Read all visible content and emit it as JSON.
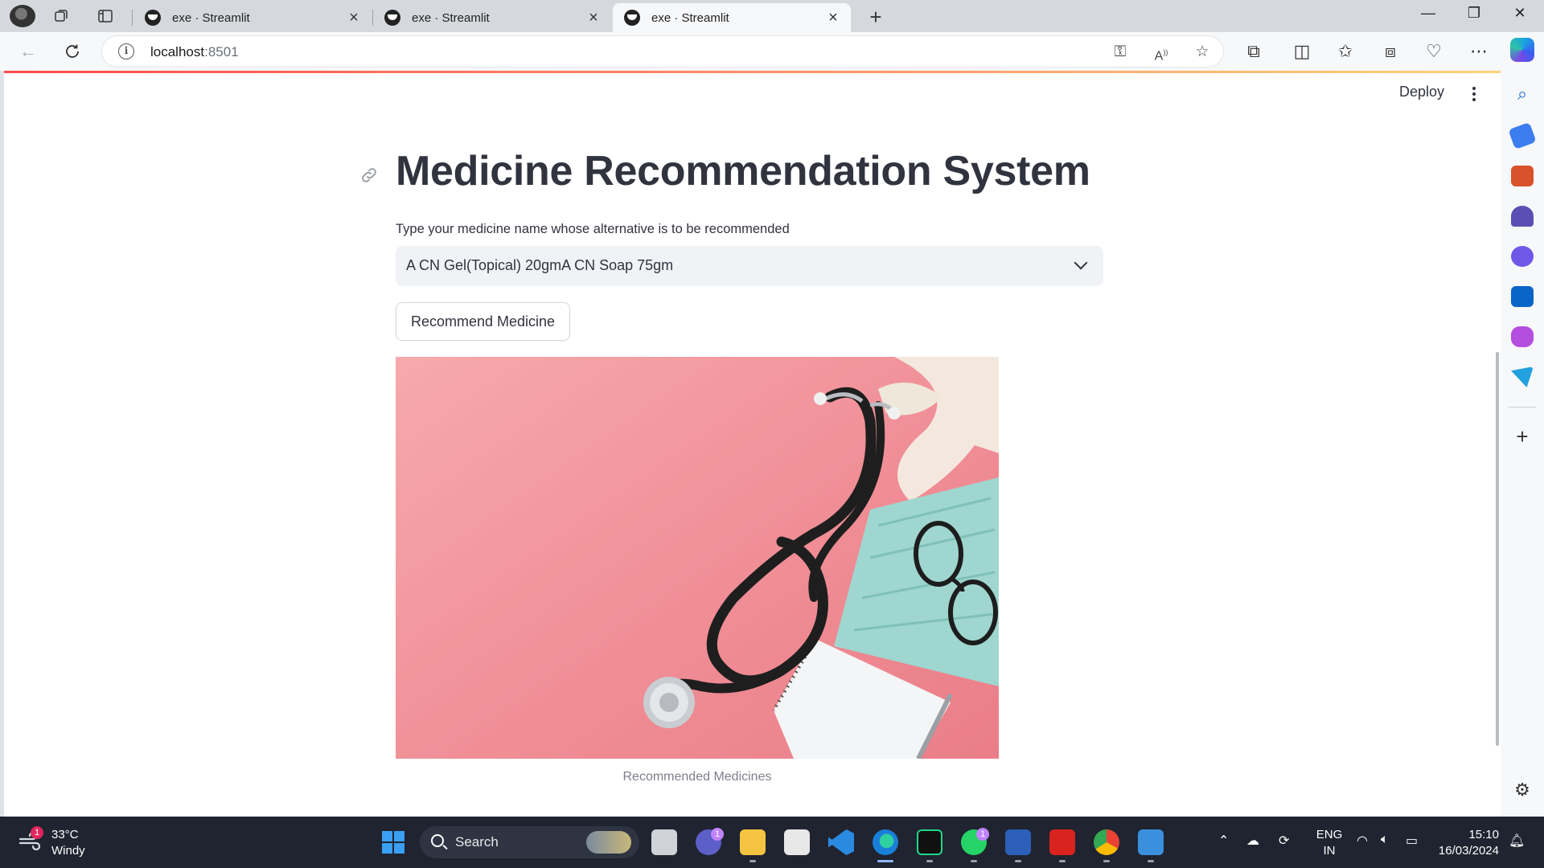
{
  "browser": {
    "tabs": [
      {
        "title": "exe · Streamlit",
        "active": false
      },
      {
        "title": "exe · Streamlit",
        "active": false
      },
      {
        "title": "exe · Streamlit",
        "active": true
      }
    ],
    "address": {
      "host": "localhost",
      "port": ":8501"
    },
    "accent_color": "#ff4b4b"
  },
  "app": {
    "deploy_label": "Deploy",
    "title": "Medicine Recommendation System",
    "select_label": "Type your medicine name whose alternative is to be recommended",
    "select_value": "A CN Gel(Topical) 20gmA CN Soap 75gm",
    "button_label": "Recommend Medicine",
    "image_caption": "Recommended Medicines"
  },
  "taskbar": {
    "weather": {
      "temp": "33°C",
      "condition": "Windy",
      "badge": "1"
    },
    "search_label": "Search",
    "teams_badge": "1",
    "whatsapp_badge": "1",
    "lang_top": "ENG",
    "lang_bottom": "IN",
    "time": "15:10",
    "date": "16/03/2024"
  }
}
